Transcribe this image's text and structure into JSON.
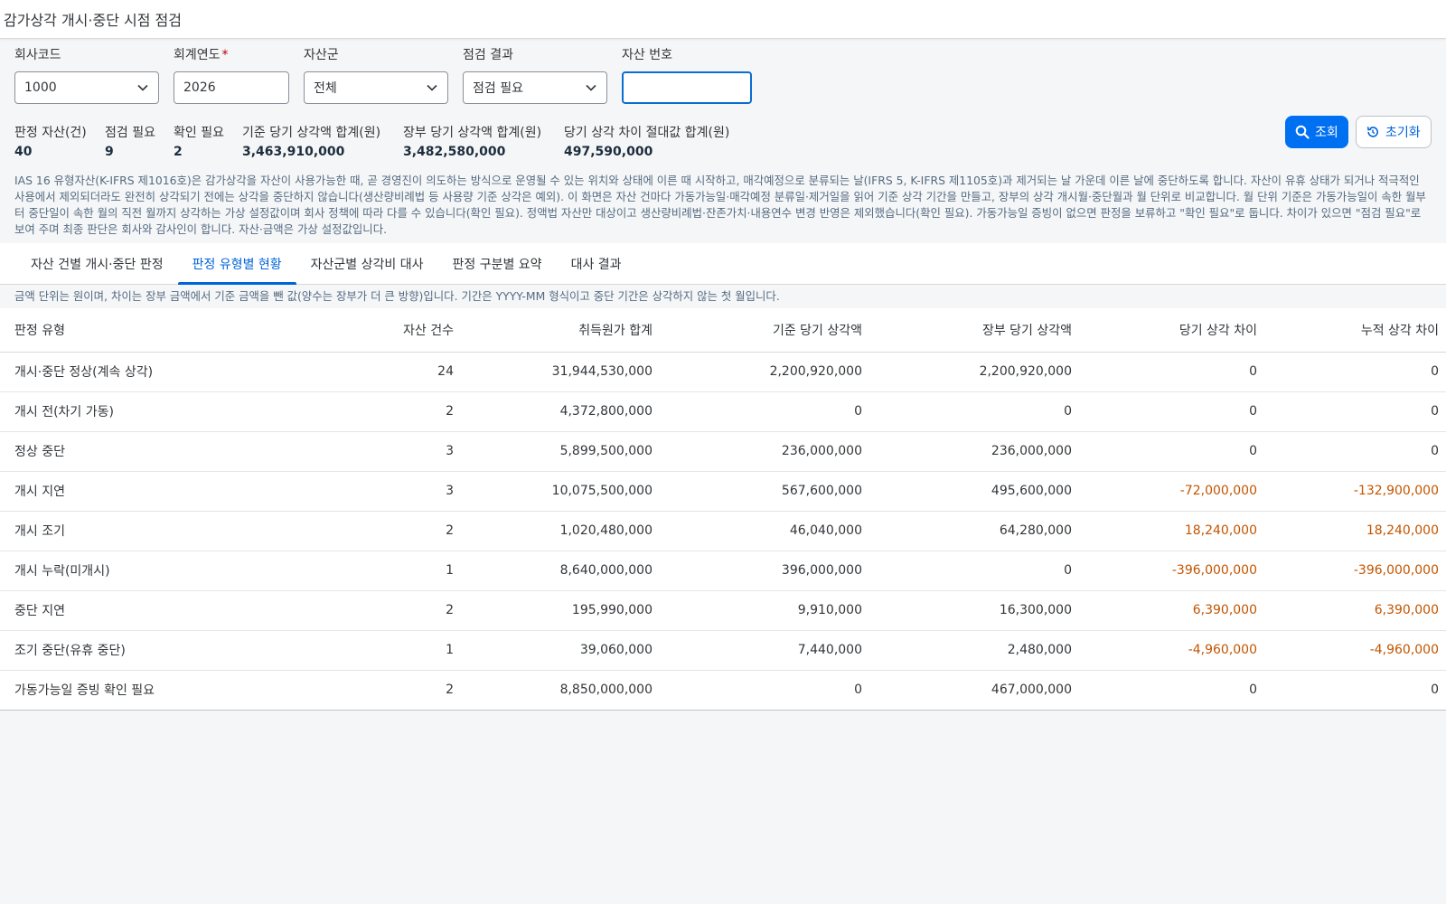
{
  "app": {
    "title": "감가상각 개시·중단 시점 점검"
  },
  "filters": {
    "company": {
      "label": "회사코드",
      "value": "1000"
    },
    "fiscal_year": {
      "label": "회계연도",
      "required_mark": "*",
      "value": "2026"
    },
    "asset_class": {
      "label": "자산군",
      "value": "전체"
    },
    "check_result": {
      "label": "점검 결과",
      "value": "점검 필요"
    },
    "asset_number": {
      "label": "자산 번호",
      "value": "",
      "placeholder": ""
    }
  },
  "buttons": {
    "search": "조회",
    "reset": "초기화"
  },
  "kpis": [
    {
      "label": "판정 자산(건)",
      "value": "40"
    },
    {
      "label": "점검 필요",
      "value": "9"
    },
    {
      "label": "확인 필요",
      "value": "2"
    },
    {
      "label": "기준 당기 상각액 합계(원)",
      "value": "3,463,910,000"
    },
    {
      "label": "장부 당기 상각액 합계(원)",
      "value": "3,482,580,000"
    },
    {
      "label": "당기 상각 차이 절대값 합계(원)",
      "value": "497,590,000"
    }
  ],
  "notice": "IAS 16 유형자산(K-IFRS 제1016호)은 감가상각을 자산이 사용가능한 때, 곧 경영진이 의도하는 방식으로 운영될 수 있는 위치와 상태에 이른 때 시작하고, 매각예정으로 분류되는 날(IFRS 5, K-IFRS 제1105호)과 제거되는 날 가운데 이른 날에 중단하도록 합니다. 자산이 유휴 상태가 되거나 적극적인 사용에서 제외되더라도 완전히 상각되기 전에는 상각을 중단하지 않습니다(생산량비례법 등 사용량 기준 상각은 예외). 이 화면은 자산 건마다 가동가능일·매각예정 분류일·제거일을 읽어 기준 상각 기간을 만들고, 장부의 상각 개시월·중단월과 월 단위로 비교합니다. 월 단위 기준은 가동가능일이 속한 월부터 중단일이 속한 월의 직전 월까지 상각하는 가상 설정값이며 회사 정책에 따라 다를 수 있습니다(확인 필요). 정액법 자산만 대상이고 생산량비례법·잔존가치·내용연수 변경 반영은 제외했습니다(확인 필요). 가동가능일 증빙이 없으면 판정을 보류하고 \"확인 필요\"로 둡니다. 차이가 있으면 \"점검 필요\"로 보여 주며 최종 판단은 회사와 감사인이 합니다. 자산·금액은 가상 설정값입니다.",
  "tabs": [
    {
      "label": "자산 건별 개시·중단 판정",
      "active": false
    },
    {
      "label": "판정 유형별 현황",
      "active": true
    },
    {
      "label": "자산군별 상각비 대사",
      "active": false
    },
    {
      "label": "판정 구분별 요약",
      "active": false
    },
    {
      "label": "대사 결과",
      "active": false
    }
  ],
  "unit_note": "금액 단위는 원이며, 차이는 장부 금액에서 기준 금액을 뺀 값(양수는 장부가 더 큰 방향)입니다. 기간은 YYYY-MM 형식이고 중단 기간은 상각하지 않는 첫 월입니다.",
  "table": {
    "columns": [
      "판정 유형",
      "자산 건수",
      "취득원가 합계",
      "기준 당기 상각액",
      "장부 당기 상각액",
      "당기 상각 차이",
      "누적 상각 차이"
    ],
    "rows": [
      [
        "개시·중단 정상(계속 상각)",
        "24",
        "31,944,530,000",
        "2,200,920,000",
        "2,200,920,000",
        "0",
        "0"
      ],
      [
        "개시 전(차기 가동)",
        "2",
        "4,372,800,000",
        "0",
        "0",
        "0",
        "0"
      ],
      [
        "정상 중단",
        "3",
        "5,899,500,000",
        "236,000,000",
        "236,000,000",
        "0",
        "0"
      ],
      [
        "개시 지연",
        "3",
        "10,075,500,000",
        "567,600,000",
        "495,600,000",
        "-72,000,000",
        "-132,900,000"
      ],
      [
        "개시 조기",
        "2",
        "1,020,480,000",
        "46,040,000",
        "64,280,000",
        "18,240,000",
        "18,240,000"
      ],
      [
        "개시 누락(미개시)",
        "1",
        "8,640,000,000",
        "396,000,000",
        "0",
        "-396,000,000",
        "-396,000,000"
      ],
      [
        "중단 지연",
        "2",
        "195,990,000",
        "9,910,000",
        "16,300,000",
        "6,390,000",
        "6,390,000"
      ],
      [
        "조기 중단(유휴 중단)",
        "1",
        "39,060,000",
        "7,440,000",
        "2,480,000",
        "-4,960,000",
        "-4,960,000"
      ],
      [
        "가동가능일 증빙 확인 필요",
        "2",
        "8,850,000,000",
        "0",
        "467,000,000",
        "0",
        "0"
      ]
    ]
  },
  "colors": {
    "accent": "#0064d9",
    "primary_button": "#0070f2",
    "variance": "#c35500"
  }
}
